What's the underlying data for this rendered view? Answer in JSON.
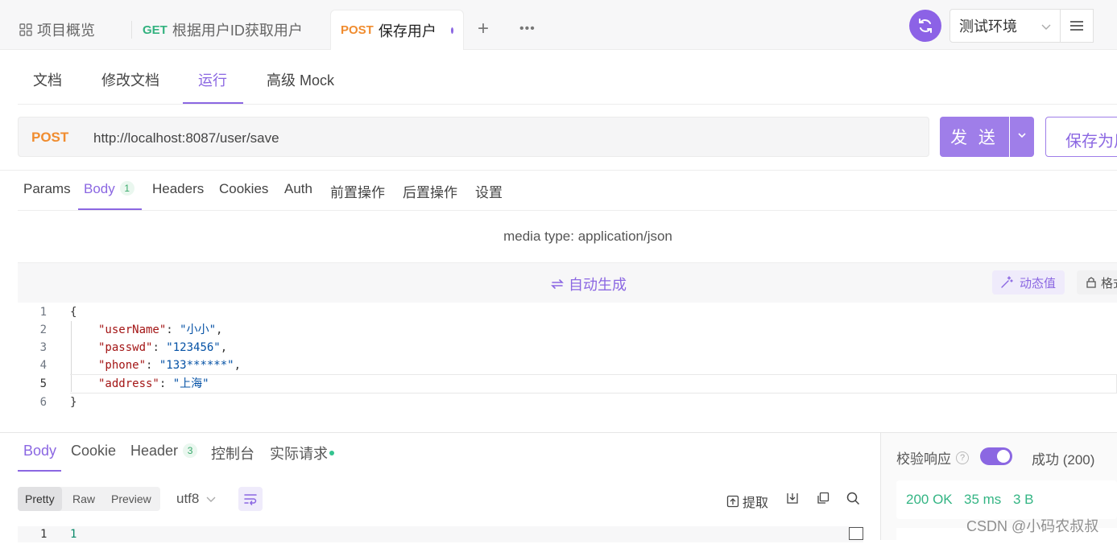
{
  "tabs": [
    {
      "icon": "grid-icon",
      "label": "项目概览"
    },
    {
      "method": "GET",
      "label": "根据用户ID获取用户",
      "method_color": "#33b27f"
    },
    {
      "method": "POST",
      "label": "保存用户",
      "method_color": "#f08c2f",
      "active": true
    }
  ],
  "env": {
    "label": "测试环境"
  },
  "subnav": [
    "文档",
    "修改文档",
    "运行",
    "高级 Mock"
  ],
  "subnav_active": "运行",
  "request": {
    "method": "POST",
    "url": "http://localhost:8087/user/save",
    "send_label": "发 送",
    "save_as_label": "保存为用"
  },
  "req_tabs": {
    "params": "Params",
    "body": "Body",
    "body_count": "1",
    "headers": "Headers",
    "cookies": "Cookies",
    "auth": "Auth",
    "pre": "前置操作",
    "post": "后置操作",
    "settings": "设置"
  },
  "media_type": "media type: application/json",
  "editor": {
    "autogen": "自动生成",
    "dynamic": "动态值",
    "format": "格式",
    "line_numbers": [
      "1",
      "2",
      "3",
      "4",
      "5",
      "6"
    ],
    "open_brace": "{",
    "close_brace": "}",
    "fields": [
      {
        "key": "\"userName\"",
        "value": "\"小小\"",
        "comma": ","
      },
      {
        "key": "\"passwd\"",
        "value": "\"123456\"",
        "comma": ","
      },
      {
        "key": "\"phone\"",
        "value": "\"133******\"",
        "comma": ","
      },
      {
        "key": "\"address\"",
        "value": "\"上海\"",
        "comma": ""
      }
    ]
  },
  "response": {
    "tabs": {
      "body": "Body",
      "cookie": "Cookie",
      "header": "Header",
      "header_count": "3",
      "console": "控制台",
      "actual": "实际请求"
    },
    "view": {
      "pretty": "Pretty",
      "raw": "Raw",
      "preview": "Preview"
    },
    "encoding": "utf8",
    "extract": "提取",
    "line1": "1",
    "value1": "1",
    "verify_label": "校验响应",
    "success": "成功 (200)",
    "status": "200 OK",
    "time": "35 ms",
    "size": "3 B"
  },
  "watermark": "CSDN @小码农叔叔",
  "colors": {
    "accent": "#8b67e2",
    "post": "#f08c2f",
    "get": "#33b27f",
    "ok": "#34b584"
  }
}
